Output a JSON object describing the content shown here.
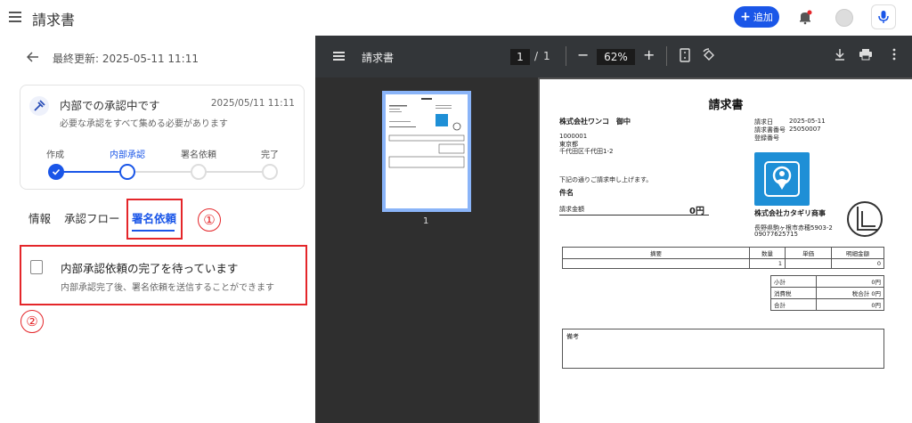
{
  "header": {
    "title": "請求書",
    "add_label": "追加"
  },
  "left": {
    "last_updated": "最終更新: 2025-05-11 11:11",
    "card": {
      "title": "内部での承認中です",
      "date": "2025/05/11 11:11",
      "subtitle": "必要な承認をすべて集める必要があります"
    },
    "steps": [
      {
        "label": "作成",
        "state": "done"
      },
      {
        "label": "内部承認",
        "state": "current"
      },
      {
        "label": "署名依頼",
        "state": "pending"
      },
      {
        "label": "完了",
        "state": "pending"
      }
    ],
    "tabs": [
      {
        "label": "情報"
      },
      {
        "label": "承認フロー"
      },
      {
        "label": "署名依頼"
      }
    ],
    "annotations": [
      "①",
      "②"
    ],
    "wait": {
      "title": "内部承認依頼の完了を待っています",
      "subtitle": "内部承認完了後、署名依頼を送信することができます"
    }
  },
  "viewer": {
    "title": "請求書",
    "page_current": "1",
    "page_sep": "/",
    "page_total": "1",
    "zoom": "62%",
    "thumb_label": "1"
  },
  "doc": {
    "title": "請求書",
    "recipient": "株式会社ワンコ　御中",
    "postal": "1000001",
    "pref": "東京都",
    "addr": "千代田区千代田1-2",
    "issue_label": "請求日",
    "issue_date": "2025-05-11",
    "number_label": "請求書番号",
    "number": "25050007",
    "reg_label": "登録番号",
    "intro": "下記の通りご請求申し上げます。",
    "subject_label": "件名",
    "amount_label": "請求金額",
    "amount": "0円",
    "company": "株式会社カタギリ商事",
    "company_addr": "長野県駒ヶ根市赤穂5903-2",
    "company_tel": "09077625715",
    "table_headers": [
      "摘要",
      "数量",
      "単価",
      "明細金額"
    ],
    "row": {
      "qty": "1",
      "price": "",
      "total": "0"
    },
    "subtotal_label": "小計",
    "subtotal": "0円",
    "tax_label": "消費税",
    "tax": "税合計 0円",
    "total_label": "合計",
    "total": "0円",
    "remarks_label": "備考"
  },
  "colors": {
    "accent": "#1a56e8",
    "annotation": "#e4262a"
  }
}
